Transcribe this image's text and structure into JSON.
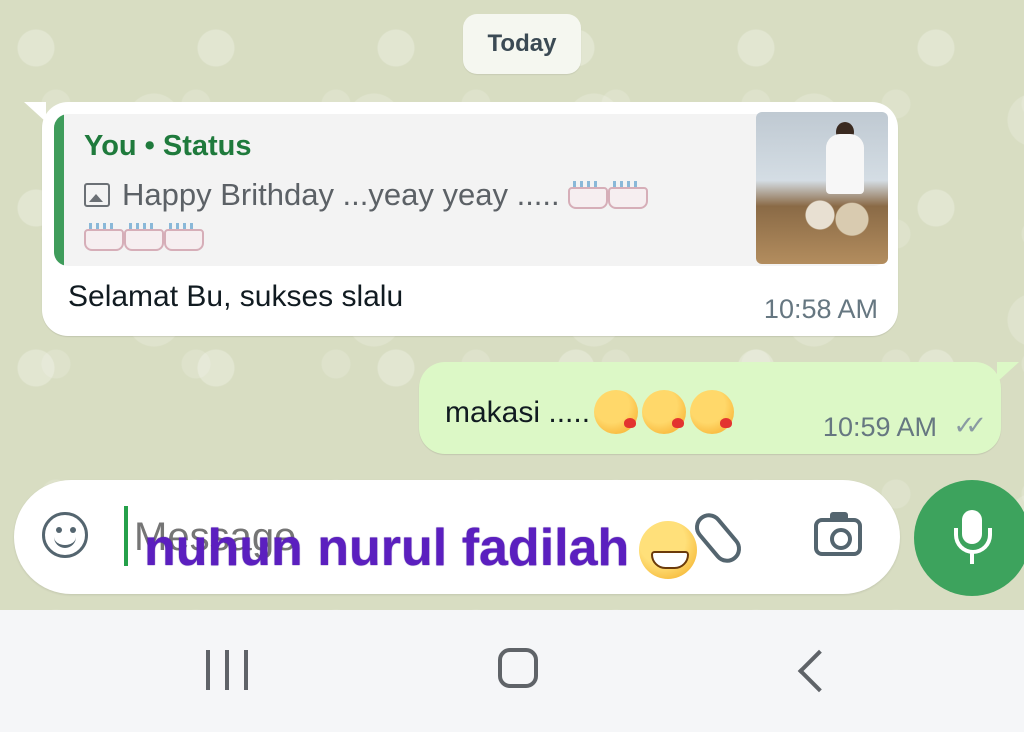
{
  "chat": {
    "date_label": "Today",
    "incoming": {
      "quote_author": "You • Status",
      "quote_text": "Happy Brithday ...yeay yeay .....",
      "quote_cakes": 5,
      "text": "Selamat Bu, sukses slalu",
      "time": "10:58 AM"
    },
    "outgoing": {
      "text": "makasi .....",
      "emoji_count": 3,
      "time": "10:59 AM",
      "status": "✓✓"
    }
  },
  "composer": {
    "placeholder": "Message",
    "overlay_text": "nuhun nurul fadilah"
  },
  "colors": {
    "wallpaper": "#d8ddc2",
    "incoming_bubble": "#ffffff",
    "outgoing_bubble": "#dcf8c6",
    "accent": "#3da35d",
    "overlay_text": "#5b1fbf"
  },
  "icons": {
    "emoji": "emoji-icon",
    "attach": "paperclip-icon",
    "camera": "camera-icon",
    "mic": "mic-icon",
    "nav_recent": "recent-apps-icon",
    "nav_home": "home-icon",
    "nav_back": "back-icon"
  }
}
